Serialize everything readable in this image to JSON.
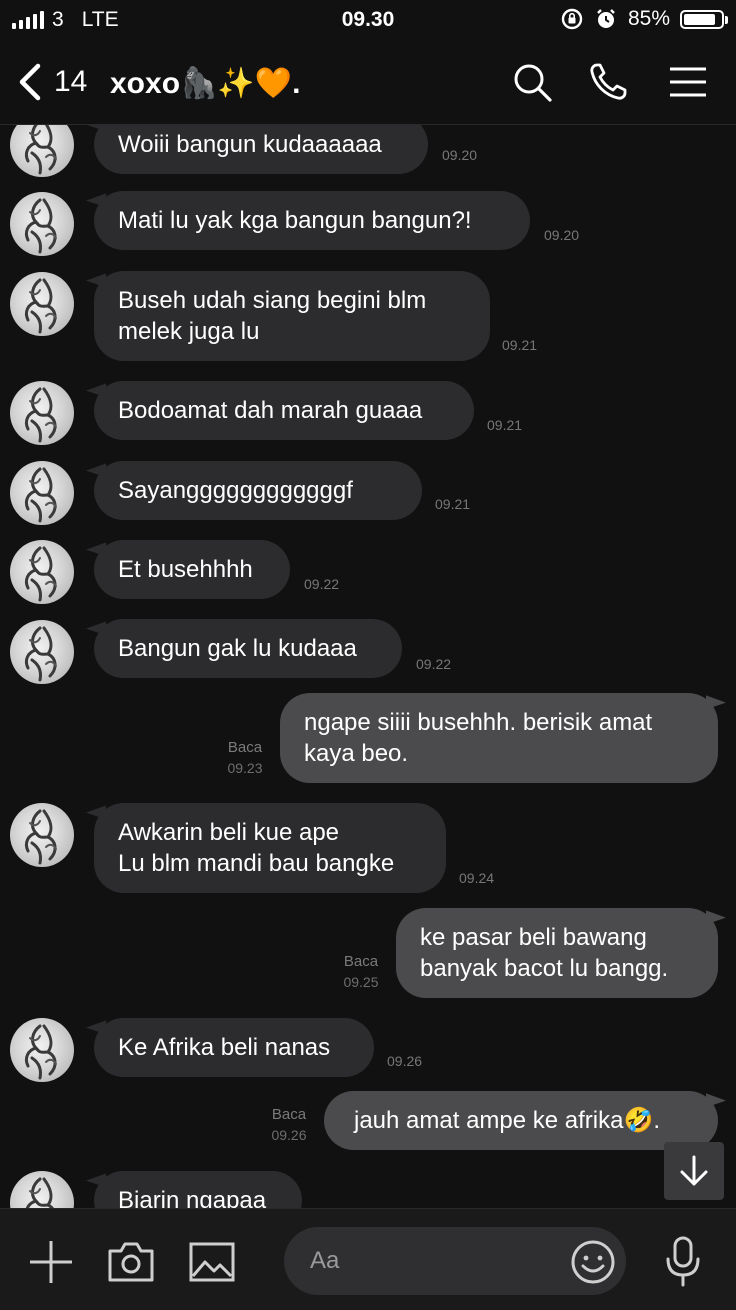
{
  "status_bar": {
    "carrier": "3",
    "network": "LTE",
    "time": "09.30",
    "battery_percent": "85%",
    "battery_level": 0.85
  },
  "header": {
    "back_count": "14",
    "title": "xoxo🦍✨🧡.",
    "icons": [
      "search-icon",
      "phone-icon",
      "menu-icon"
    ]
  },
  "messages": [
    {
      "dir": "in",
      "text": "Woiii bangun kudaaaaaa",
      "time": "09.20"
    },
    {
      "dir": "in",
      "text": "Mati lu yak kga bangun bangun?!",
      "time": "09.20"
    },
    {
      "dir": "in",
      "text": "Buseh udah siang begini blm\nmelek juga lu",
      "time": "09.21"
    },
    {
      "dir": "in",
      "text": "Bodoamat dah marah guaaa",
      "time": "09.21"
    },
    {
      "dir": "in",
      "text": "Sayanggggggggggggf",
      "time": "09.21"
    },
    {
      "dir": "in",
      "text": "Et busehhhh",
      "time": "09.22"
    },
    {
      "dir": "in",
      "text": "Bangun gak lu kudaaa",
      "time": "09.22"
    },
    {
      "dir": "out",
      "text": "ngape siiii busehhh. berisik amat\nkaya beo.",
      "read": "Baca",
      "time": "09.23"
    },
    {
      "dir": "in",
      "text": "Awkarin beli kue ape\nLu blm mandi bau bangke",
      "time": "09.24"
    },
    {
      "dir": "out",
      "text": "ke pasar beli bawang\nbanyak bacot lu bangg.",
      "read": "Baca",
      "time": "09.25"
    },
    {
      "dir": "in",
      "text": "Ke Afrika beli nanas",
      "time": "09.26"
    },
    {
      "dir": "out",
      "text": "jauh amat ampe ke afrika🤣.",
      "read": "Baca",
      "time": "09.26"
    },
    {
      "dir": "in",
      "text": "Biarin ngapaa",
      "time": ""
    }
  ],
  "input": {
    "placeholder": "Aa"
  },
  "colors": {
    "background": "#111112",
    "incoming_bubble": "#2c2c2e",
    "outgoing_bubble": "#4b4b4d",
    "timestamp": "#777777"
  }
}
